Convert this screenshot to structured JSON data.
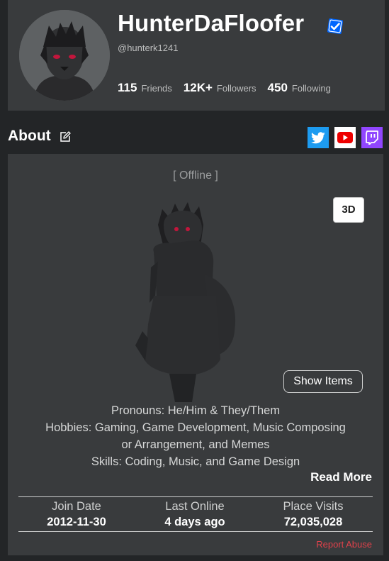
{
  "profile": {
    "display_name": "HunterDaFloofer",
    "handle": "@hunterk1241",
    "stats": [
      {
        "value": "115",
        "label": "Friends"
      },
      {
        "value": "12K+",
        "label": "Followers"
      },
      {
        "value": "450",
        "label": "Following"
      }
    ]
  },
  "about": {
    "title": "About",
    "social": [
      "twitter-icon",
      "youtube-icon",
      "twitch-icon"
    ],
    "status": "[ Offline ]",
    "view_toggle": "3D",
    "show_items": "Show Items",
    "bio": [
      "Pronouns: He/Him & They/Them",
      "Hobbies: Gaming, Game Development, Music Composing",
      "or Arrangement, and Memes",
      "Skills: Coding, Music, and Game Design"
    ],
    "read_more": "Read More",
    "info": {
      "join_label": "Join Date",
      "join_value": "2012-11-30",
      "online_label": "Last Online",
      "online_value": "4 days ago",
      "visits_label": "Place Visits",
      "visits_value": "72,035,028"
    },
    "report": "Report Abuse"
  },
  "colors": {
    "background": "#232527",
    "card": "#393b3d",
    "verified": "#0066ff",
    "report": "#e0414a"
  }
}
